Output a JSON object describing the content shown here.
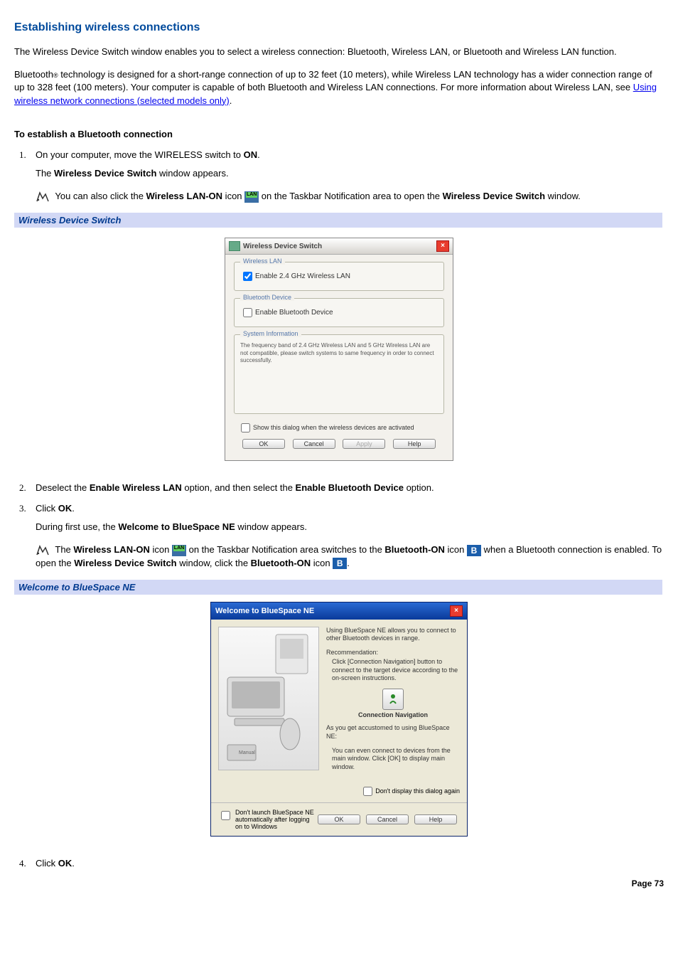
{
  "heading": "Establishing wireless connections",
  "intro1": "The Wireless Device Switch window enables you to select a wireless connection: Bluetooth, Wireless LAN, or Bluetooth and Wireless LAN function.",
  "intro2_a": "Bluetooth",
  "intro2_reg": "®",
  "intro2_b": " technology is designed for a short-range connection of up to 32 feet (10 meters), while Wireless LAN technology has a wider connection range of up to 328 feet (100 meters). Your computer is capable of both Bluetooth and Wireless LAN connections. For more information about Wireless LAN, see ",
  "intro2_link": "Using wireless network connections (selected models only)",
  "intro2_c": ".",
  "subhead1": "To establish a Bluetooth connection",
  "step1_a": "On your computer, move the WIRELESS switch to ",
  "step1_on": "ON",
  "step1_b": ".",
  "step1_p2_a": "The ",
  "step1_p2_b": "Wireless Device Switch",
  "step1_p2_c": " window appears.",
  "note1_a": " You can also click the ",
  "note1_b": "Wireless LAN-ON",
  "note1_c": " icon ",
  "note1_d": " on the Taskbar Notification area to open the ",
  "note1_e": "Wireless Device Switch",
  "note1_f": " window.",
  "caption1": "Wireless Device Switch",
  "wds": {
    "title": "Wireless Device Switch",
    "g1": "Wireless LAN",
    "cb1": "Enable 2.4 GHz Wireless LAN",
    "g2": "Bluetooth Device",
    "cb2": "Enable Bluetooth Device",
    "g3": "System Information",
    "sysinfo": "The frequency band of 2.4 GHz Wireless LAN and 5 GHz Wireless LAN are not compatible, please switch systems to same frequency in order to connect successfully.",
    "cb3": "Show this dialog when the wireless devices are activated",
    "ok": "OK",
    "cancel": "Cancel",
    "apply": "Apply",
    "help": "Help"
  },
  "step2_a": "Deselect the ",
  "step2_b": "Enable Wireless LAN",
  "step2_c": " option, and then select the ",
  "step2_d": "Enable Bluetooth Device",
  "step2_e": " option.",
  "step3_a": "Click ",
  "step3_b": "OK",
  "step3_c": ".",
  "step3_p2_a": "During first use, the ",
  "step3_p2_b": "Welcome to BlueSpace NE",
  "step3_p2_c": " window appears.",
  "note2_a": " The ",
  "note2_b": "Wireless LAN-ON",
  "note2_c": " icon ",
  "note2_d": " on the Taskbar Notification area switches to the ",
  "note2_e": "Bluetooth-ON",
  "note2_f": " icon ",
  "note2_g": " when a Bluetooth connection is enabled. To open the ",
  "note2_h": "Wireless Device Switch",
  "note2_i": " window, click the ",
  "note2_j": "Bluetooth-ON",
  "note2_k": " icon ",
  "note2_l": ".",
  "caption2": "Welcome to BlueSpace NE",
  "bs": {
    "title": "Welcome to BlueSpace NE",
    "p1": "Using BlueSpace NE allows you to connect to other Bluetooth devices in range.",
    "rec": "Recommendation:",
    "p2": "Click [Connection Navigation] button to connect to the target device according to the on-screen instructions.",
    "navlabel": "Connection Navigation",
    "p3": "As you get accustomed to using BlueSpace NE:",
    "p4": "You can even connect to devices from the main window. Click [OK] to display main window.",
    "cb_right": "Don't display this dialog again",
    "cb_left": "Don't launch BlueSpace NE automatically after logging on to Windows",
    "ok": "OK",
    "cancel": "Cancel",
    "help": "Help"
  },
  "step4_a": "Click ",
  "step4_b": "OK",
  "step4_c": ".",
  "footer": "Page 73"
}
